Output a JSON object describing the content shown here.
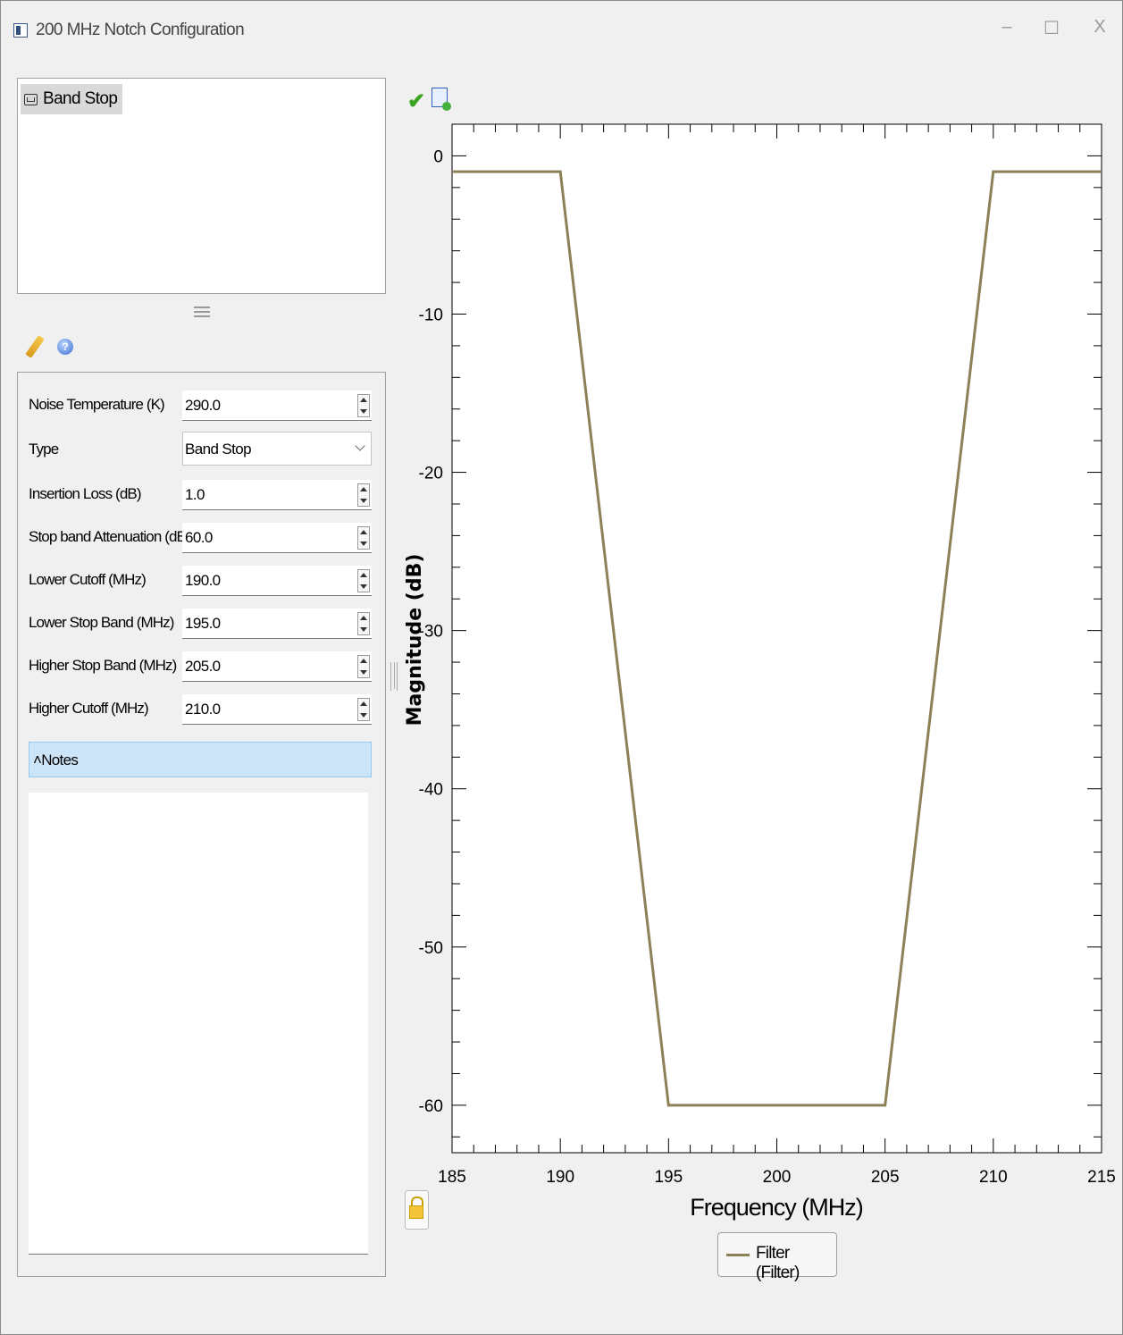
{
  "window": {
    "title": "200 MHz Notch Configuration",
    "minimize_glyph": "–",
    "maximize_glyph": "☐",
    "close_glyph": "X"
  },
  "tree": {
    "items": [
      {
        "label": "Band Stop",
        "icon": "filter-icon",
        "selected": true
      }
    ]
  },
  "toolbar": {
    "icons": [
      "pencil-icon",
      "help-icon"
    ]
  },
  "properties": {
    "noise_temperature": {
      "label": "Noise Temperature (K)",
      "value": "290.0"
    },
    "type": {
      "label": "Type",
      "value": "Band Stop"
    },
    "insertion_loss": {
      "label": "Insertion Loss (dB)",
      "value": "1.0"
    },
    "stop_band_attenuation": {
      "label": "Stop band Attenuation (dB)",
      "value": "60.0"
    },
    "lower_cutoff": {
      "label": "Lower Cutoff  (MHz)",
      "value": "190.0"
    },
    "lower_stop_band": {
      "label": "Lower Stop Band  (MHz)",
      "value": "195.0"
    },
    "higher_stop_band": {
      "label": "Higher Stop Band  (MHz)",
      "value": "205.0"
    },
    "higher_cutoff": {
      "label": "Higher Cutoff  (MHz)",
      "value": "210.0"
    }
  },
  "notes": {
    "label": "˄Notes",
    "value": ""
  },
  "chart_toolbar": {
    "icons": [
      "check-icon",
      "chart-config-icon",
      "lock-icon"
    ]
  },
  "legend": {
    "label": "Filter (Filter)"
  },
  "colors": {
    "series": "#8c8057",
    "selection": "#cce4f7"
  },
  "chart_data": {
    "type": "line",
    "xlabel": "Frequency (MHz)",
    "ylabel": "Magnitude (dB)",
    "xlim": [
      185,
      215
    ],
    "ylim": [
      -63,
      2
    ],
    "xticks": [
      185,
      190,
      195,
      200,
      205,
      210,
      215
    ],
    "yticks": [
      0,
      -10,
      -20,
      -30,
      -40,
      -50,
      -60
    ],
    "grid": false,
    "legend_position": "bottom-center",
    "series": [
      {
        "name": "Filter (Filter)",
        "color": "#8c8057",
        "x": [
          185,
          190,
          195,
          205,
          210,
          215
        ],
        "y": [
          -1,
          -1,
          -60,
          -60,
          -1,
          -1
        ]
      }
    ]
  }
}
